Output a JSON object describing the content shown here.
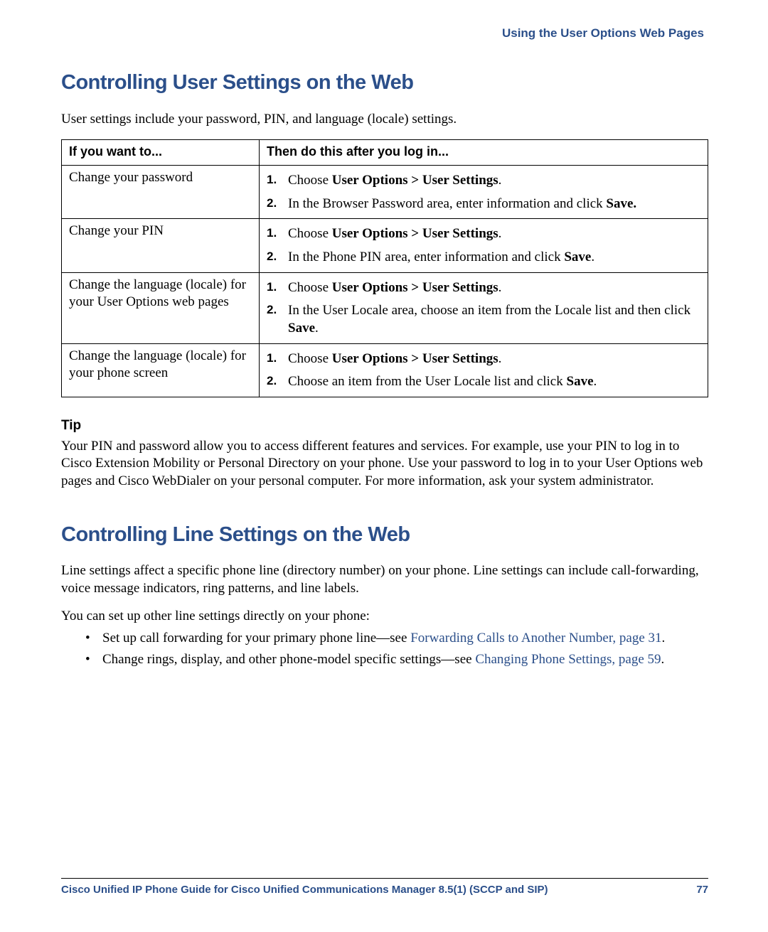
{
  "header": {
    "breadcrumb": "Using the User Options Web Pages"
  },
  "section1": {
    "title": "Controlling User Settings on the Web",
    "intro": "User settings include your password, PIN, and language (locale) settings.",
    "table": {
      "h1": "If you want to...",
      "h2": "Then do this after you log in...",
      "rows": [
        {
          "want": "Change your password",
          "s1a": "Choose ",
          "s1b": "User Options > User Settings",
          "s1c": ".",
          "s2a": "In the Browser Password area, enter information and click ",
          "s2b": "Save.",
          "s2c": ""
        },
        {
          "want": "Change your PIN",
          "s1a": "Choose ",
          "s1b": "User Options > User Settings",
          "s1c": ".",
          "s2a": "In the Phone PIN area, enter information and click ",
          "s2b": "Save",
          "s2c": "."
        },
        {
          "want": "Change the language (locale) for your User Options web pages",
          "s1a": "Choose ",
          "s1b": "User Options > User Settings",
          "s1c": ".",
          "s2a": "In the User Locale area, choose an item from the Locale list and then click ",
          "s2b": "Save",
          "s2c": "."
        },
        {
          "want": "Change the language (locale) for your phone screen",
          "s1a": "Choose ",
          "s1b": "User Options > User Settings",
          "s1c": ".",
          "s2a": "Choose an item from the User Locale list and click ",
          "s2b": "Save",
          "s2c": "."
        }
      ]
    },
    "tip": {
      "head": "Tip",
      "body": "Your PIN and password allow you to access different features and services. For example, use your PIN to log in to Cisco Extension Mobility or Personal Directory on your phone. Use your password to log in to your User Options web pages and Cisco WebDialer on your personal computer. For more information, ask your system administrator."
    }
  },
  "section2": {
    "title": "Controlling Line Settings on the Web",
    "p1": "Line settings affect a specific phone line (directory number) on your phone. Line settings can include call-forwarding, voice message indicators, ring patterns, and line labels.",
    "p2": "You can set up other line settings directly on your phone:",
    "b1a": "Set up call forwarding for your primary phone line—see ",
    "b1link": "Forwarding Calls to Another Number, page 31",
    "b1b": ".",
    "b2a": "Change rings, display, and other phone-model specific settings—see ",
    "b2link": "Changing Phone Settings, page 59",
    "b2b": "."
  },
  "footer": {
    "title": "Cisco Unified IP Phone Guide for Cisco Unified Communications Manager 8.5(1) (SCCP and SIP)",
    "page": "77"
  }
}
